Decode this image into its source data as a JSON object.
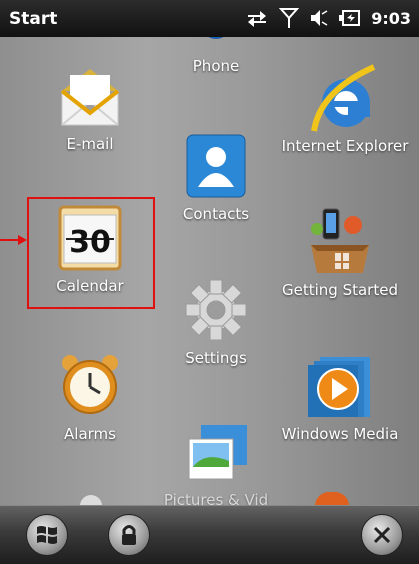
{
  "status_bar": {
    "title": "Start",
    "time": "9:03"
  },
  "tiles": {
    "email": {
      "label": "E-mail"
    },
    "phone": {
      "label": "Phone"
    },
    "internet_explorer": {
      "label": "Internet Explorer"
    },
    "calendar": {
      "label": "Calendar",
      "day": "30"
    },
    "contacts": {
      "label": "Contacts"
    },
    "getting_started": {
      "label": "Getting Started"
    },
    "settings": {
      "label": "Settings"
    },
    "alarms": {
      "label": "Alarms"
    },
    "windows_media": {
      "label": "Windows Media"
    },
    "pictures_partial": {
      "label": "Pictures & Vid"
    }
  },
  "highlight_color": "#e01010"
}
